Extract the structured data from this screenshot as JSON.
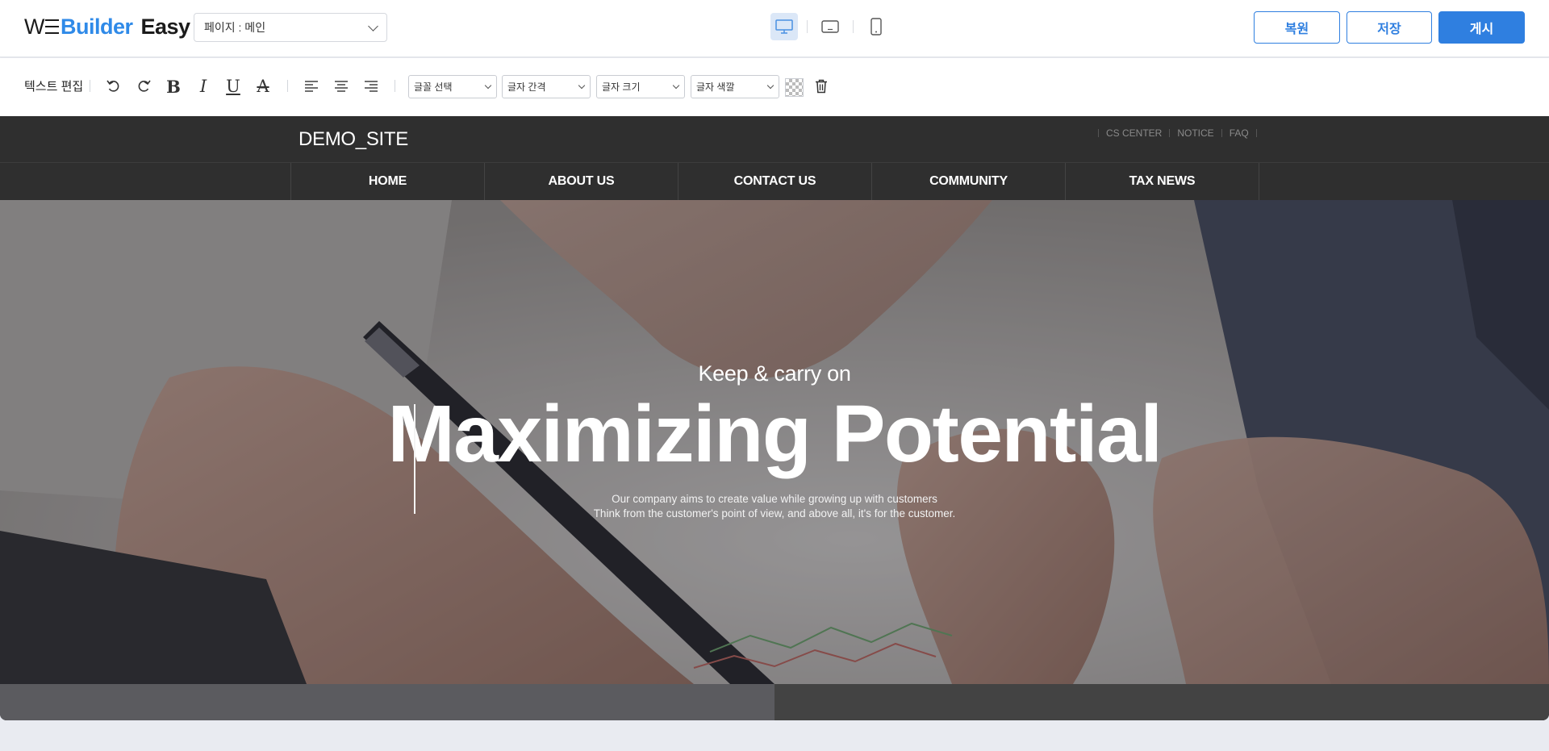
{
  "app": {
    "logo_prefix": "W",
    "logo_brand": "Builder",
    "logo_suffix": "Easy",
    "page_select_value": "페이지 : 메인",
    "devices": [
      "desktop-icon",
      "tablet-icon",
      "mobile-icon"
    ],
    "active_device": "desktop",
    "buttons": {
      "restore": "복원",
      "save": "저장",
      "publish": "게시"
    },
    "accent_color": "#2f7fe0"
  },
  "toolbar": {
    "label": "텍스트 편집",
    "icons": [
      "undo-icon",
      "redo-icon",
      "bold-icon",
      "italic-icon",
      "underline-icon",
      "strikethrough-icon",
      "align-left-icon",
      "align-center-icon",
      "align-right-icon",
      "transparent-color-icon",
      "trash-icon"
    ],
    "bold_glyph": "B",
    "italic_glyph": "I",
    "underline_glyph": "U",
    "strike_glyph": "A",
    "selects": {
      "font": "글꼴 선택",
      "spacing": "글자 간격",
      "size": "글자 크기",
      "color": "글자 색깔"
    }
  },
  "site": {
    "logo": "DEMO_SITE",
    "util_links": [
      "CS CENTER",
      "NOTICE",
      "FAQ"
    ],
    "nav": [
      "HOME",
      "ABOUT US",
      "CONTACT US",
      "COMMUNITY",
      "TAX NEWS"
    ],
    "hero": {
      "subtitle": "Keep & carry on",
      "title": "Maximizing Potential",
      "desc_line1": "Our company aims to create value while growing up with customers",
      "desc_line2": "Think from the customer's point of view, and above all, it's for the customer."
    }
  }
}
